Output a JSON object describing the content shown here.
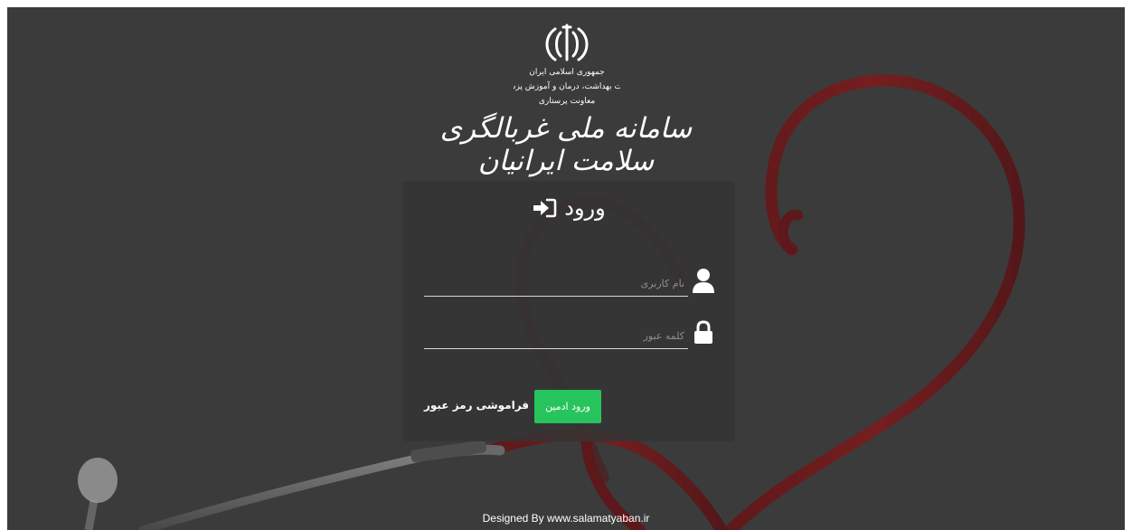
{
  "header": {
    "emblem_lines": [
      "جمهوری اسلامی ایران",
      "وزارت بهداشت، درمان و آموزش پزشکی",
      "معاونت پرستاری"
    ],
    "system_title": "سامانه ملی غربالگری سلامت ایرانیان"
  },
  "login": {
    "title": "ورود",
    "title_icon": "sign-in-icon",
    "username": {
      "placeholder": "نام کاربری",
      "value": "",
      "icon": "user-icon"
    },
    "password": {
      "placeholder": "کلمه عبور",
      "value": "",
      "icon": "lock-icon"
    },
    "admin_button_label": "ورود ادمین",
    "forgot_link_label": "فراموشی رمز عبور",
    "accent_color": "#27c45d"
  },
  "footer": {
    "credit": "Designed By www.salamatyaban.ir"
  }
}
